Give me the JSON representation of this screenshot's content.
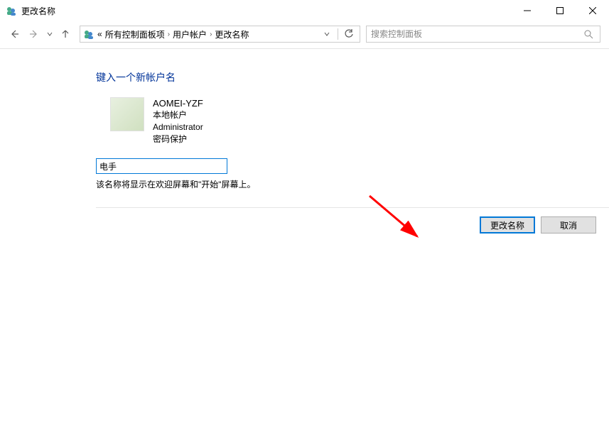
{
  "titlebar": {
    "title": "更改名称"
  },
  "breadcrumb": {
    "prefix": "«",
    "items": [
      "所有控制面板项",
      "用户帐户",
      "更改名称"
    ]
  },
  "search": {
    "placeholder": "搜索控制面板"
  },
  "content": {
    "heading": "键入一个新帐户名",
    "account": {
      "name": "AOMEI-YZF",
      "type": "本地帐户",
      "role": "Administrator",
      "pw": "密码保护"
    },
    "input_value": "电手",
    "hint": "该名称将显示在欢迎屏幕和\"开始\"屏幕上。"
  },
  "buttons": {
    "primary": "更改名称",
    "cancel": "取消"
  }
}
